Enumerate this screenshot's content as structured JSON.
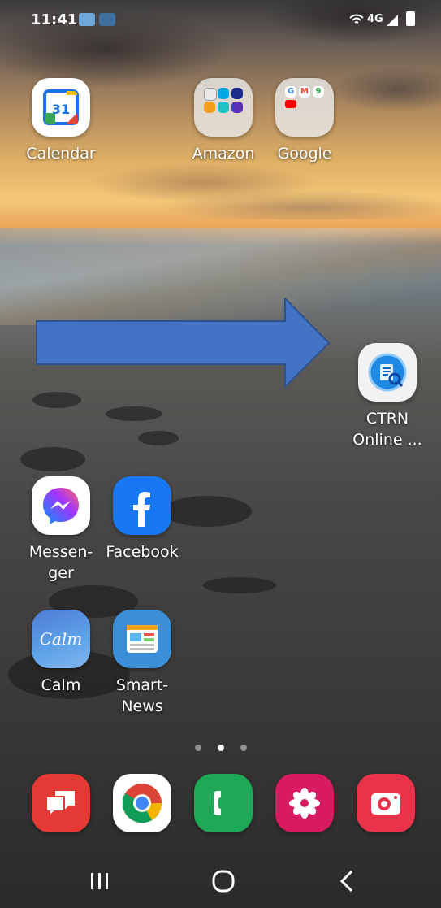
{
  "status_bar": {
    "time": "11:41",
    "network": "4G"
  },
  "home_apps": {
    "calendar": {
      "label": "Calendar",
      "date": "31",
      "icon": "calendar-icon"
    },
    "amazon_folder": {
      "label": "Amazon",
      "icon": "folder-icon"
    },
    "google_folder": {
      "label": "Google",
      "icon": "folder-icon",
      "mini_letters": [
        "G",
        "M",
        "9"
      ]
    },
    "ctrn": {
      "label_line1": "CTRN",
      "label_line2": "Online ...",
      "icon": "ctrn-globe-icon"
    },
    "messenger": {
      "label_line1": "Messen-",
      "label_line2": "ger",
      "icon": "messenger-icon"
    },
    "facebook": {
      "label": "Facebook",
      "icon": "facebook-icon"
    },
    "calm": {
      "label": "Calm",
      "icon_text": "Calm",
      "icon": "calm-icon"
    },
    "smartnews": {
      "label_line1": "Smart-",
      "label_line2": "News",
      "icon": "smartnews-icon"
    }
  },
  "page_indicator": {
    "pages": 3,
    "current": 2
  },
  "dock": [
    {
      "name": "messages",
      "icon": "chat-bubbles-icon",
      "color": "#e53935"
    },
    {
      "name": "chrome",
      "icon": "chrome-icon",
      "color": "#ffffff"
    },
    {
      "name": "phone",
      "icon": "phone-icon",
      "color": "#1fa855"
    },
    {
      "name": "flower",
      "icon": "flower-icon",
      "color": "#d81b60"
    },
    {
      "name": "camera",
      "icon": "camera-icon",
      "color": "#e8334a"
    }
  ],
  "nav_bar": {
    "recent": "recent-apps-icon",
    "home": "home-icon",
    "back": "back-icon"
  },
  "colors": {
    "arrow_fill": "#4472c4",
    "arrow_stroke": "#2f528f"
  }
}
